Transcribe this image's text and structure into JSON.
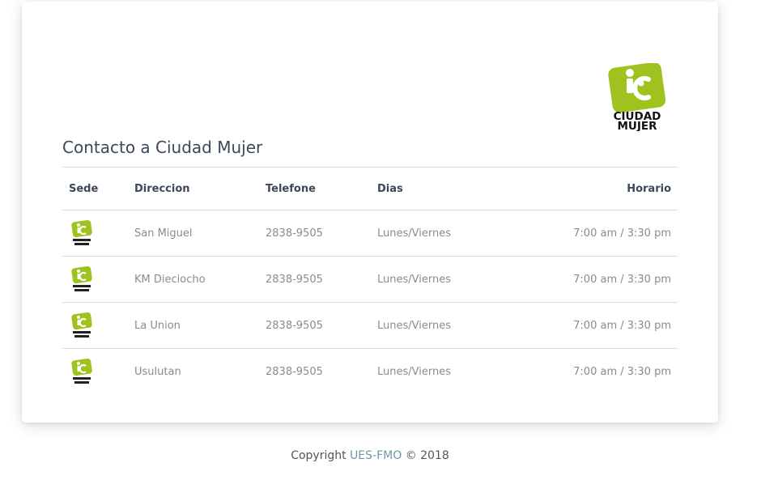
{
  "brand": {
    "logo_line1": "CIUDAD",
    "logo_line2": "MUJER",
    "accent_color": "#9fc21e"
  },
  "page": {
    "title": "Contacto a Ciudad Mujer"
  },
  "table": {
    "headers": [
      "Sede",
      "Direccion",
      "Telefone",
      "Dias",
      "Horario"
    ],
    "rows": [
      {
        "direccion": "San Miguel",
        "telefono": "2838-9505",
        "dias": "Lunes/Viernes",
        "horario": "7:00 am / 3:30 pm"
      },
      {
        "direccion": "KM Dieciocho",
        "telefono": "2838-9505",
        "dias": "Lunes/Viernes",
        "horario": "7:00 am / 3:30 pm"
      },
      {
        "direccion": "La Union",
        "telefono": "2838-9505",
        "dias": "Lunes/Viernes",
        "horario": "7:00 am / 3:30 pm"
      },
      {
        "direccion": "Usulutan",
        "telefono": "2838-9505",
        "dias": "Lunes/Viernes",
        "horario": "7:00 am / 3:30 pm"
      }
    ]
  },
  "footer": {
    "prefix": "Copyright",
    "link": "UES-FMO",
    "suffix": "© 2018"
  }
}
